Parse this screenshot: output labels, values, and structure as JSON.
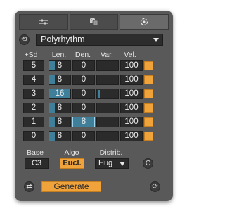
{
  "tabs": [
    {
      "icon": "sliders-icon",
      "active": false
    },
    {
      "icon": "dice-icon",
      "active": false
    },
    {
      "icon": "target-icon",
      "active": true
    }
  ],
  "preset": {
    "value": "Polyrhythm"
  },
  "headers": {
    "sd": "+Sd",
    "len": "Len.",
    "den": "Den.",
    "var": "Var.",
    "vel": "Vel."
  },
  "rows": [
    {
      "sd": "5",
      "len": "8",
      "den": "0",
      "var_level": 0,
      "vel": "100",
      "den_highlight": false
    },
    {
      "sd": "4",
      "len": "8",
      "den": "0",
      "var_level": 0,
      "vel": "100",
      "den_highlight": false
    },
    {
      "sd": "3",
      "len": "16",
      "den": "0",
      "var_level": 0.08,
      "vel": "100",
      "den_highlight": false
    },
    {
      "sd": "2",
      "len": "8",
      "den": "0",
      "var_level": 0,
      "vel": "100",
      "den_highlight": false
    },
    {
      "sd": "1",
      "len": "8",
      "den": "8",
      "var_level": 0,
      "vel": "100",
      "den_highlight": true
    },
    {
      "sd": "0",
      "len": "8",
      "den": "0",
      "var_level": 0,
      "vel": "100",
      "den_highlight": false
    }
  ],
  "len_max": 16,
  "settings": {
    "base_label": "Base",
    "base_value": "C3",
    "algo_label": "Algo",
    "algo_value": "Eucl.",
    "distrib_label": "Distrib.",
    "distrib_value": "Hug",
    "c_button": "C"
  },
  "generate_label": "Generate",
  "colors": {
    "accent": "#f0a33a",
    "bar": "#3f7f9a",
    "panel": "#595959"
  }
}
